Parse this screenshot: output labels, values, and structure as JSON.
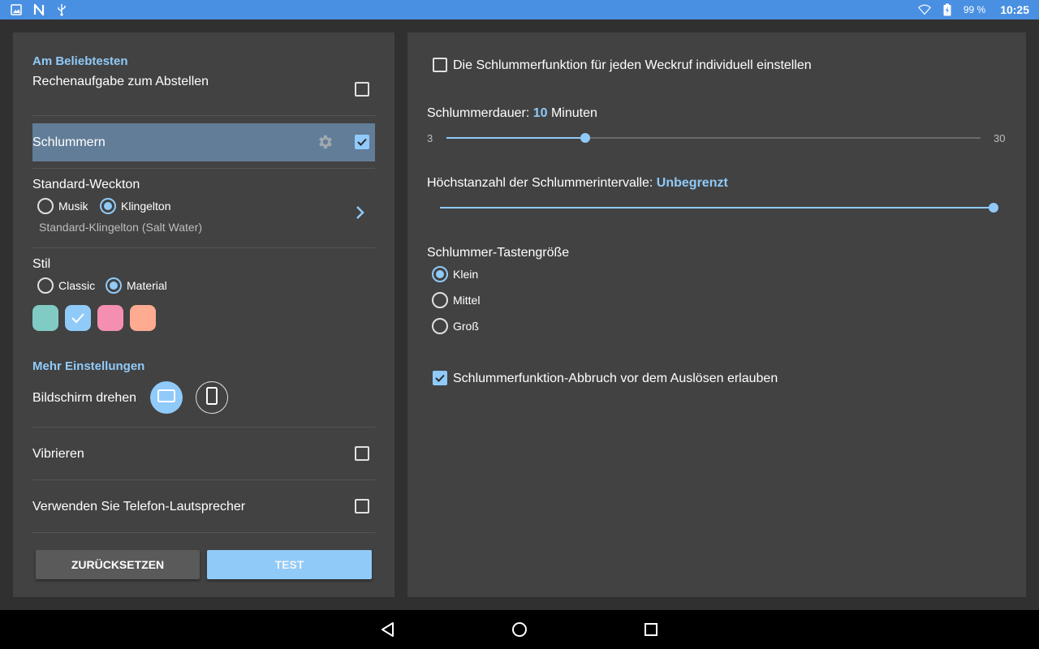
{
  "status_bar": {
    "battery_percent": "99 %",
    "time": "10:25"
  },
  "left": {
    "section_popular": "Am Beliebtesten",
    "math_task": {
      "label": "Rechenaufgabe zum Abstellen",
      "checked": false
    },
    "snooze": {
      "label": "Schlummern",
      "checked": true
    },
    "ringtone": {
      "title": "Standard-Weckton",
      "options": [
        "Musik",
        "Klingelton"
      ],
      "selected": "Klingelton",
      "subtitle": "Standard-Klingelton (Salt Water)"
    },
    "style": {
      "title": "Stil",
      "options": [
        "Classic",
        "Material"
      ],
      "selected": "Material",
      "colors": [
        "#80cbc4",
        "#90caf9",
        "#f48fb1",
        "#ffab91"
      ],
      "selected_color_index": 1
    },
    "section_more": "Mehr Einstellungen",
    "rotate": {
      "label": "Bildschirm drehen",
      "selected": "landscape"
    },
    "vibrate": {
      "label": "Vibrieren",
      "checked": false
    },
    "speaker": {
      "label": "Verwenden Sie Telefon-Lautsprecher",
      "checked": false
    },
    "buttons": {
      "reset": "ZURÜCKSETZEN",
      "test": "TEST"
    }
  },
  "right": {
    "individual": {
      "label": "Die Schlummerfunktion für jeden Weckruf individuell einstellen",
      "checked": false
    },
    "duration": {
      "prefix": "Schlummerdauer: ",
      "value": "10",
      "suffix": " Minuten",
      "min_label": "3",
      "max_label": "30",
      "min": 3,
      "max": 30,
      "current": 10
    },
    "max_intervals": {
      "prefix": "Höchstanzahl der Schlummerintervalle: ",
      "value": "Unbegrenzt",
      "fraction": 1.0
    },
    "button_size": {
      "title": "Schlummer-Tastengröße",
      "options": [
        "Klein",
        "Mittel",
        "Groß"
      ],
      "selected": "Klein"
    },
    "dismiss": {
      "label": "Schlummerfunktion-Abbruch vor dem Auslösen erlauben",
      "checked": true
    }
  },
  "icons": {
    "status_left": [
      "image-icon",
      "n-icon",
      "usb-icon"
    ],
    "status_right": [
      "wifi-icon",
      "battery-charging-icon"
    ],
    "nav": [
      "back-icon",
      "home-icon",
      "recents-icon"
    ]
  }
}
